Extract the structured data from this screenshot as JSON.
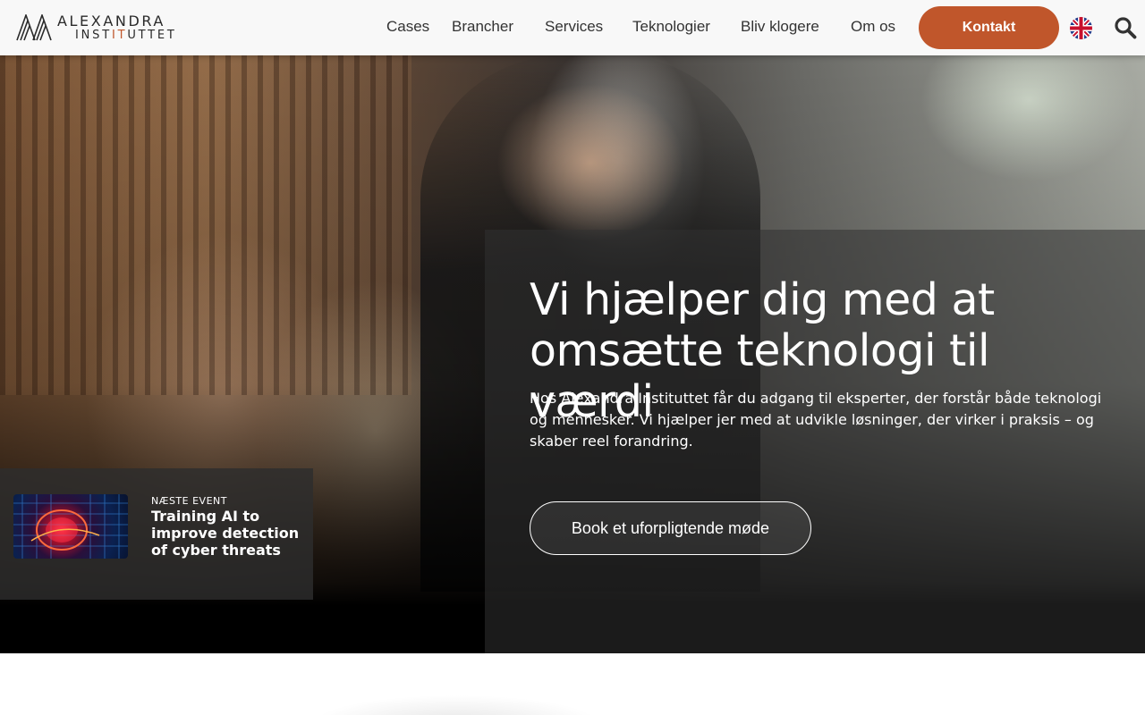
{
  "brand": {
    "name_line1": "ALEXANDRA",
    "name_line2_pre": "INST",
    "name_line2_it": "IT",
    "name_line2_post": "UTTET",
    "accent_color": "#c0562b"
  },
  "nav": {
    "items": [
      {
        "label": "Cases"
      },
      {
        "label": "Brancher"
      },
      {
        "label": "Services"
      },
      {
        "label": "Teknologier"
      },
      {
        "label": "Bliv klogere"
      },
      {
        "label": "Om os"
      }
    ],
    "contact_label": "Kontakt",
    "language_icon": "uk-flag-icon",
    "search_icon": "search-icon"
  },
  "hero": {
    "title": "Vi hjælper dig med at omsætte teknologi til værdi",
    "text": "Hos Alexandra Instituttet får du adgang til eksperter, der forstår både teknologi og mennesker. Vi hjælper jer med at udvikle løsninger, der virker i praksis – og skaber reel forandring.",
    "cta_label": "Book et uforpligtende møde"
  },
  "event": {
    "kicker": "NÆSTE EVENT",
    "title": "Training AI to improve detection of cyber threats"
  }
}
